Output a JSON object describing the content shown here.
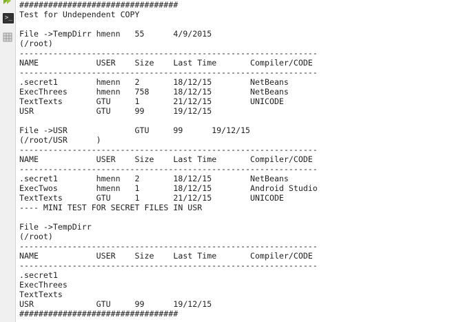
{
  "gutter": {
    "icons": [
      "run-icon",
      "terminal-icon",
      "grid-icon"
    ],
    "terminal_prompt": ">_"
  },
  "output": {
    "lines": [
      "#################################",
      "Test for Undependent COPY",
      "",
      "File ->TempDirr hmenn   55      4/9/2015",
      "(/root)",
      "--------------------------------------------------------------",
      "NAME            USER    Size    Last Time       Compiler/CODE",
      "--------------------------------------------------------------",
      ".secret1        hmenn   2       18/12/15        NetBeans",
      "ExecThrees      hmenn   758     18/12/15        NetBeans",
      "TextTexts       GTU     1       21/12/15        UNICODE",
      "USR             GTU     99      19/12/15",
      "",
      "File ->USR              GTU     99      19/12/15",
      "(/root/USR      )",
      "--------------------------------------------------------------",
      "NAME            USER    Size    Last Time       Compiler/CODE",
      "--------------------------------------------------------------",
      ".secret1        hmenn   2       18/12/15        NetBeans",
      "ExecTwos        hmenn   1       18/12/15        Android Studio",
      "TextTexts       GTU     1       21/12/15        UNICODE",
      "---- MINI TEST FOR SECRET FILES IN USR",
      "",
      "File ->TempDirr",
      "(/root)",
      "--------------------------------------------------------------",
      "NAME            USER    Size    Last Time       Compiler/CODE",
      "--------------------------------------------------------------",
      ".secret1",
      "ExecThrees",
      "TextTexts",
      "USR             GTU     99      19/12/15",
      "#################################"
    ]
  }
}
